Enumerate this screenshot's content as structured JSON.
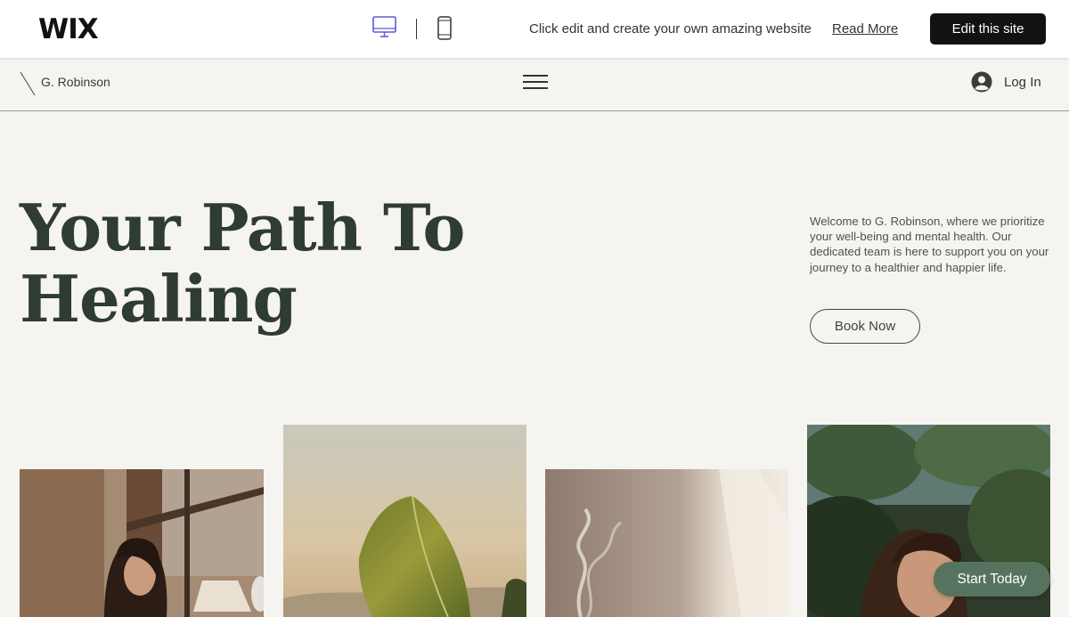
{
  "wix_bar": {
    "logo": "WIX",
    "promo_text": "Click edit and create your own amazing website",
    "read_more": "Read More",
    "edit_button": "Edit this site",
    "devices": [
      "desktop-icon",
      "mobile-icon"
    ]
  },
  "header": {
    "site_name": "G. Robinson",
    "menu_icon": "hamburger-icon",
    "login_label": "Log In",
    "login_icon": "user-avatar-icon"
  },
  "hero": {
    "title_line1": "Your Path To",
    "title_line2": "Healing",
    "intro": "Welcome to G. Robinson, where we prioritize your well-being and mental health. Our dedicated team is here to support you on your journey to a healthier and happier life.",
    "book_button": "Book Now"
  },
  "floating": {
    "start_button": "Start Today"
  },
  "colors": {
    "page_bg": "#f6f4f1",
    "heading": "#2f3b35",
    "accent_green": "#56735f",
    "wix_button": "#121212"
  }
}
